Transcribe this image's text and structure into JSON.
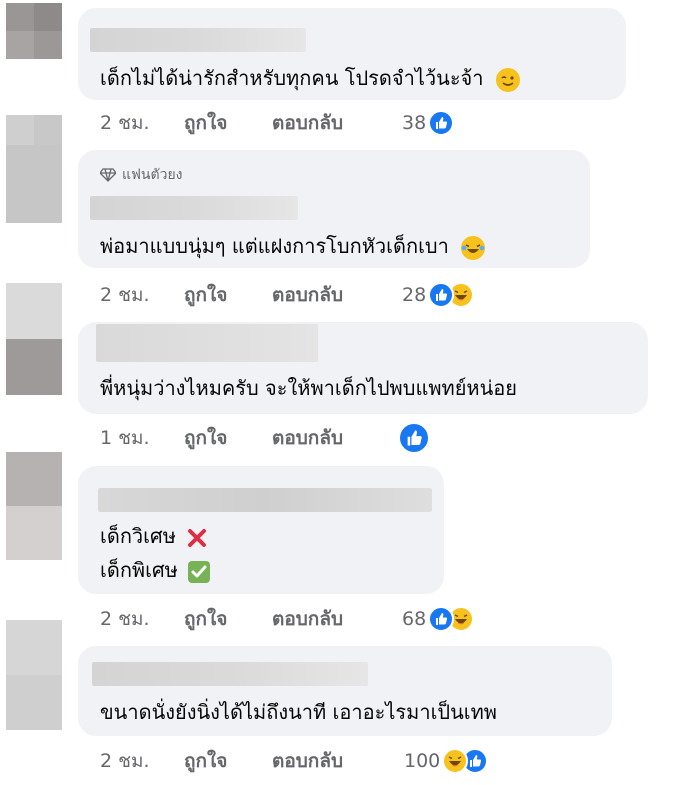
{
  "comments": [
    {
      "text": "เด็กไม่ได้น่ารักสำหรับทุกคน โปรดจำไว้นะจ้า",
      "emoji_icon": "winking-face-icon",
      "time": "2 ชม.",
      "like_label": "ถูกใจ",
      "reply_label": "ตอบกลับ",
      "reaction_count": "38",
      "reactions": [
        "like"
      ]
    },
    {
      "badge": "แฟนตัวยง",
      "badge_icon": "diamond-icon",
      "text": "พ่อมาแบบนุ่มๆ แต่แฝงการโบกหัวเด็กเบา",
      "emoji_icon": "laughing-tears-icon",
      "time": "2 ชม.",
      "like_label": "ถูกใจ",
      "reply_label": "ตอบกลับ",
      "reaction_count": "28",
      "reactions": [
        "like",
        "haha"
      ]
    },
    {
      "text": "พี่หนุ่มว่างไหมครับ จะให้พาเด็กไปพบแพทย์หน่อย",
      "time": "1 ชม.",
      "like_label": "ถูกใจ",
      "reply_label": "ตอบกลับ",
      "reaction_count": "",
      "reactions": [
        "like"
      ]
    },
    {
      "text_line1": "เด็กวิเศษ",
      "line1_icon": "cross-mark-icon",
      "text_line2": "เด็กพิเศษ",
      "line2_icon": "check-mark-icon",
      "time": "2 ชม.",
      "like_label": "ถูกใจ",
      "reply_label": "ตอบกลับ",
      "reaction_count": "68",
      "reactions": [
        "like",
        "haha"
      ]
    },
    {
      "text": "ขนาดนั่งยังนิ่งได้ไม่ถึงนาที เอาอะไรมาเป็นเทพ",
      "time": "2 ชม.",
      "like_label": "ถูกใจ",
      "reply_label": "ตอบกลับ",
      "reaction_count": "100",
      "reactions": [
        "haha",
        "like"
      ]
    }
  ],
  "colors": {
    "bubble": "#f0f2f5",
    "meta_text": "#65676b",
    "like_blue": "#1877f2",
    "haha_yellow": "#f7c21e"
  }
}
